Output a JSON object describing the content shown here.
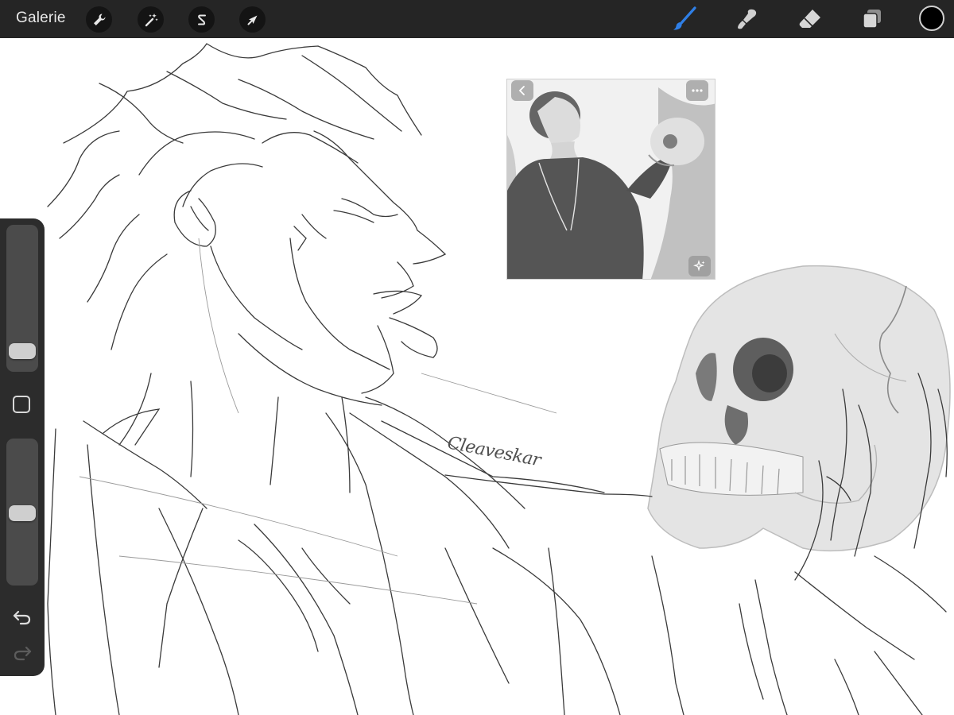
{
  "toolbar": {
    "gallery_label": "Galerie",
    "left_tools": [
      {
        "name": "wrench-icon",
        "label": "Actions"
      },
      {
        "name": "magic-wand-icon",
        "label": "Adjustments"
      },
      {
        "name": "selection-s-icon",
        "label": "Selection"
      },
      {
        "name": "transform-arrow-icon",
        "label": "Transform"
      }
    ],
    "right_tools": [
      {
        "name": "brush-icon",
        "label": "Paint",
        "active": true
      },
      {
        "name": "smudge-icon",
        "label": "Smudge"
      },
      {
        "name": "eraser-icon",
        "label": "Eraser"
      },
      {
        "name": "layers-icon",
        "label": "Layers"
      }
    ],
    "active_color": "#000000",
    "accent_color": "#2f7fe6"
  },
  "sidebar": {
    "brush_size_level": 0.08,
    "opacity_level": 0.49,
    "undo_icon": "undo-icon",
    "redo_icon": "redo-icon",
    "modify_icon": "square-modify-icon"
  },
  "reference": {
    "back_icon": "chevron-left-icon",
    "more_icon": "more-dots-icon",
    "magic_icon": "sparkle-icon"
  },
  "canvas": {
    "signature": "Cleaveskar"
  }
}
